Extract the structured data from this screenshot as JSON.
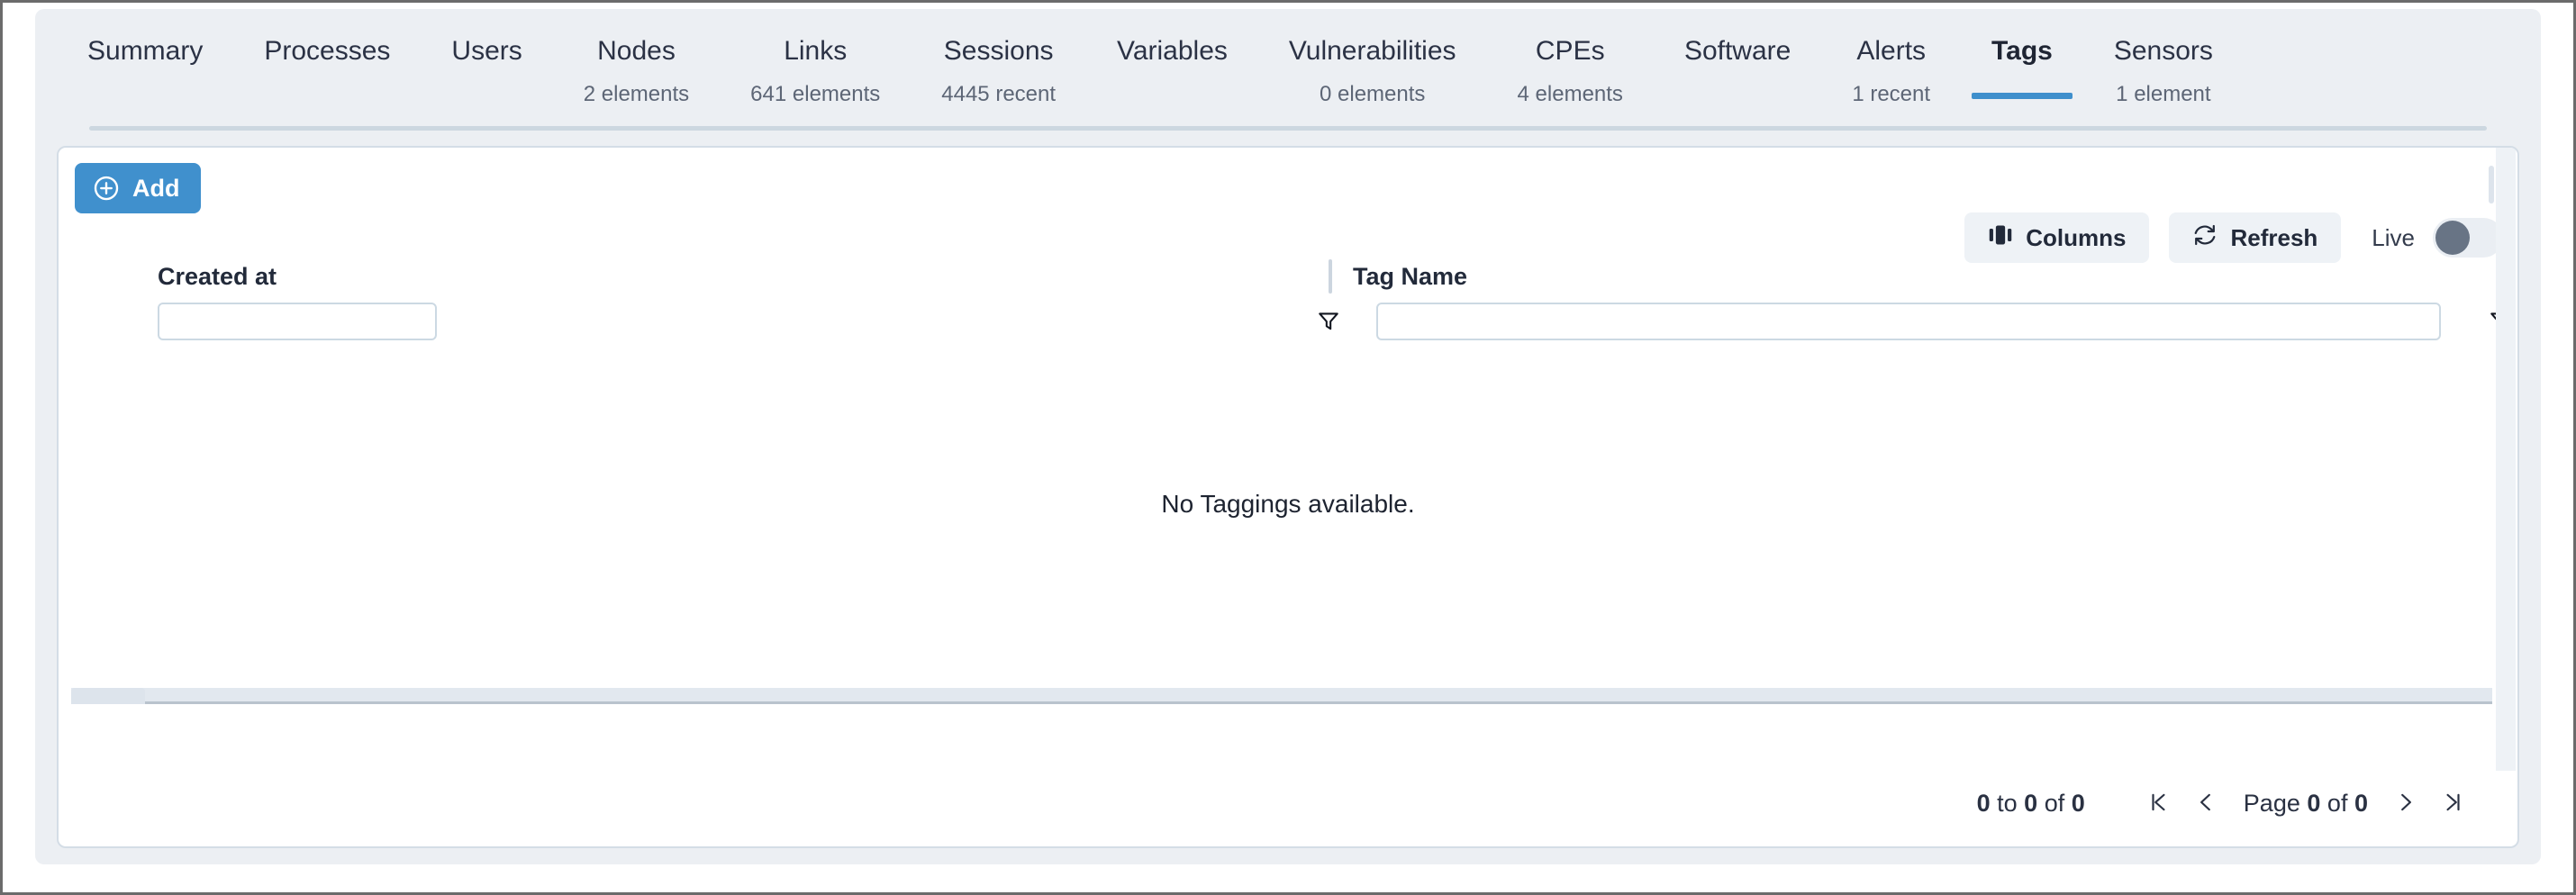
{
  "tabs": [
    {
      "label": "Summary",
      "sub": "",
      "active": false
    },
    {
      "label": "Processes",
      "sub": "",
      "active": false
    },
    {
      "label": "Users",
      "sub": "",
      "active": false
    },
    {
      "label": "Nodes",
      "sub": "2 elements",
      "active": false
    },
    {
      "label": "Links",
      "sub": "641 elements",
      "active": false
    },
    {
      "label": "Sessions",
      "sub": "4445 recent",
      "active": false
    },
    {
      "label": "Variables",
      "sub": "",
      "active": false
    },
    {
      "label": "Vulnerabilities",
      "sub": "0 elements",
      "active": false
    },
    {
      "label": "CPEs",
      "sub": "4 elements",
      "active": false
    },
    {
      "label": "Software",
      "sub": "",
      "active": false
    },
    {
      "label": "Alerts",
      "sub": "1 recent",
      "active": false
    },
    {
      "label": "Tags",
      "sub": "",
      "active": true
    },
    {
      "label": "Sensors",
      "sub": "1 element",
      "active": false
    }
  ],
  "toolbar": {
    "add_label": "Add",
    "add_icon": "plus-circle-icon",
    "columns_label": "Columns",
    "columns_icon": "columns-icon",
    "refresh_label": "Refresh",
    "refresh_icon": "refresh-icon",
    "live_label": "Live",
    "live_toggle_state": "off"
  },
  "grid": {
    "columns": [
      {
        "title": "Created at",
        "filter_value": "",
        "filter_placeholder": ""
      },
      {
        "title": "Tag Name",
        "filter_value": "",
        "filter_placeholder": ""
      }
    ],
    "filter_icon": "funnel-icon",
    "empty_message": "No Taggings available."
  },
  "pagination": {
    "range_from": "0",
    "range_to": "0",
    "range_total": "0",
    "range_sep_1": "to",
    "range_sep_2": "of",
    "page_word": "Page",
    "page_current": "0",
    "page_of": "of",
    "page_total": "0",
    "first_icon": "first-page-icon",
    "prev_icon": "previous-page-icon",
    "next_icon": "next-page-icon",
    "last_icon": "last-page-icon"
  },
  "colors": {
    "accent": "#3e8fcc",
    "add_button": "#4090cd",
    "panel_bg": "#eceff3",
    "toggle_knob": "#687485"
  }
}
